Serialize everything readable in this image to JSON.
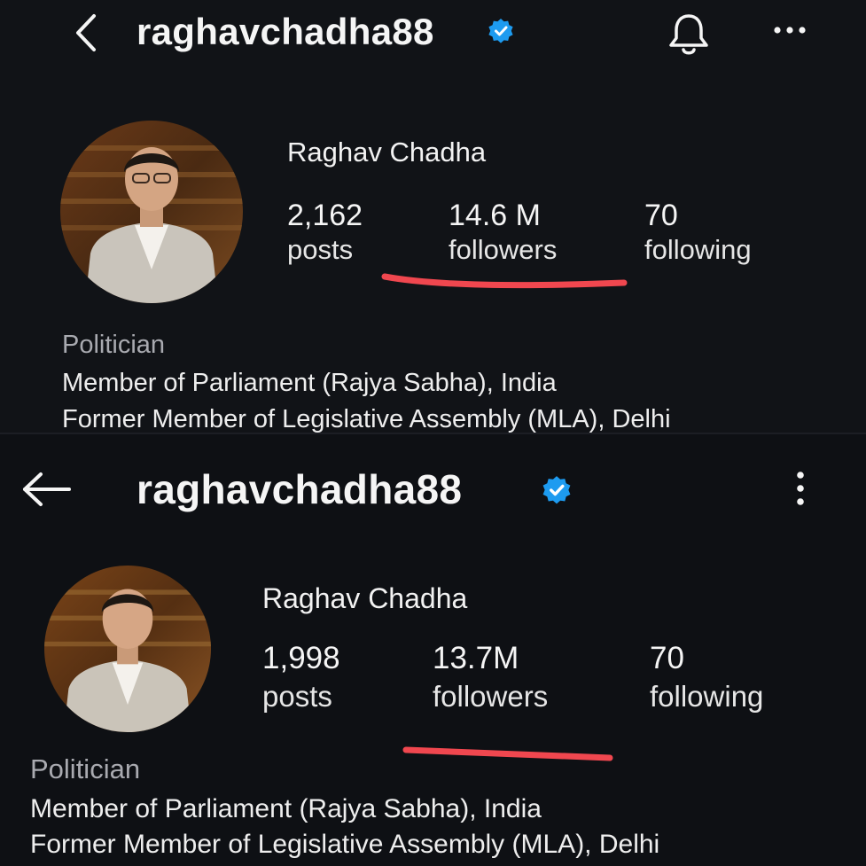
{
  "top": {
    "username": "raghavchadha88",
    "display_name": "Raghav Chadha",
    "stats": [
      {
        "value": "2,162",
        "label": "posts"
      },
      {
        "value": "14.6 M",
        "label": "followers"
      },
      {
        "value": "70",
        "label": "following"
      }
    ],
    "category": "Politician",
    "bio": [
      "Member of Parliament (Rajya Sabha), India",
      "Former Member of Legislative Assembly (MLA), Delhi"
    ],
    "icons": {
      "back": "chevron-left-icon",
      "notify": "bell-icon",
      "more": "more-horizontal-icon",
      "verified": "verified-badge-icon"
    }
  },
  "bottom": {
    "username": "raghavchadha88",
    "display_name": "Raghav Chadha",
    "stats": [
      {
        "value": "1,998",
        "label": "posts"
      },
      {
        "value": "13.7M",
        "label": "followers"
      },
      {
        "value": "70",
        "label": "following"
      }
    ],
    "category": "Politician",
    "bio": [
      "Member of Parliament (Rajya Sabha), India",
      "Former Member of Legislative Assembly (MLA), Delhi"
    ],
    "icons": {
      "back": "arrow-left-icon",
      "more": "more-vertical-icon",
      "verified": "verified-badge-icon"
    }
  },
  "colors": {
    "verified": "#1d9bf0",
    "highlight_underline": "#f0474f",
    "background": "#111317"
  }
}
